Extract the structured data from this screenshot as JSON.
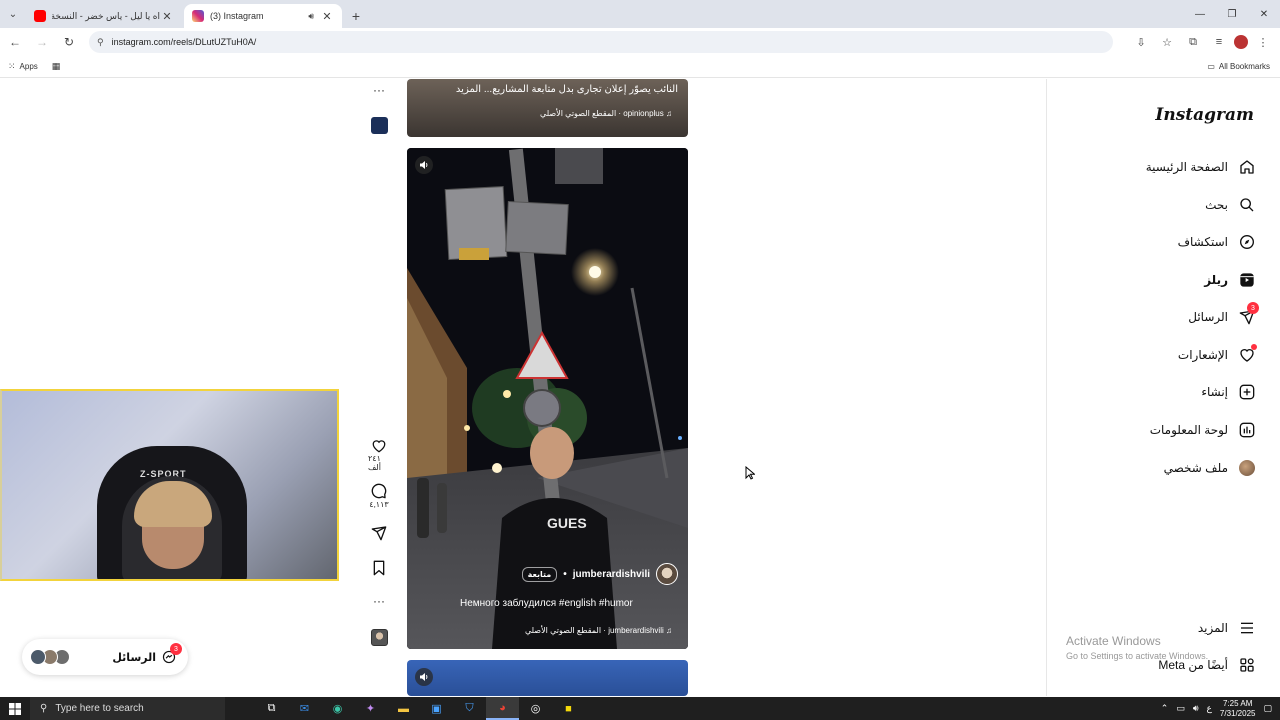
{
  "browser": {
    "tabs": [
      {
        "title": "اه يا ليل - ياس خضر - النسخة الأ",
        "color": "#ff0000",
        "active": false
      },
      {
        "title": "(3) Instagram",
        "color": "#d62976",
        "active": true
      }
    ],
    "url": "instagram.com/reels/DLutUZTuH0A/",
    "bookmarks": {
      "apps": "Apps",
      "all": "All Bookmarks"
    }
  },
  "sidebar": {
    "logo": "Instagram",
    "items": [
      {
        "label": "الصفحة الرئيسية",
        "icon": "home-icon"
      },
      {
        "label": "بحث",
        "icon": "search-icon"
      },
      {
        "label": "استكشاف",
        "icon": "compass-icon"
      },
      {
        "label": "ريلز",
        "icon": "reels-icon"
      },
      {
        "label": "الرسائل",
        "icon": "messenger-icon",
        "badge": "3"
      },
      {
        "label": "الإشعارات",
        "icon": "heart-icon"
      },
      {
        "label": "إنشاء",
        "icon": "plus-square-icon"
      },
      {
        "label": "لوحة المعلومات",
        "icon": "dashboard-icon"
      },
      {
        "label": "ملف شخصي",
        "icon": "profile-avatar"
      }
    ],
    "more": "المزيد",
    "also_meta": "أيضًا من Meta"
  },
  "reels": {
    "prev": {
      "caption": "النائب يصوّر إعلان تجارى بدل متابعة المشاريع... المزيد",
      "audio": "opinionplus · المقطع الصوتي الأصلي"
    },
    "main": {
      "username": "jumberardishvili",
      "follow": "متابعة",
      "caption": "Немного заблудился #english #humor",
      "audio": "jumberardishvili · المقطع الصوتي الأصلي",
      "likes": "٢٤١ ألف",
      "comments": "٤,١١٣"
    }
  },
  "messages_pill": {
    "label": "الرسائل",
    "badge": "3"
  },
  "windows": {
    "watermark_title": "Activate Windows",
    "watermark_sub": "Go to Settings to activate Windows.",
    "search_placeholder": "Type here to search",
    "time": "7:25 AM",
    "date": "7/31/2025",
    "lang": "ع"
  },
  "webcam": {
    "chair_brand": "Z-SPORT"
  }
}
